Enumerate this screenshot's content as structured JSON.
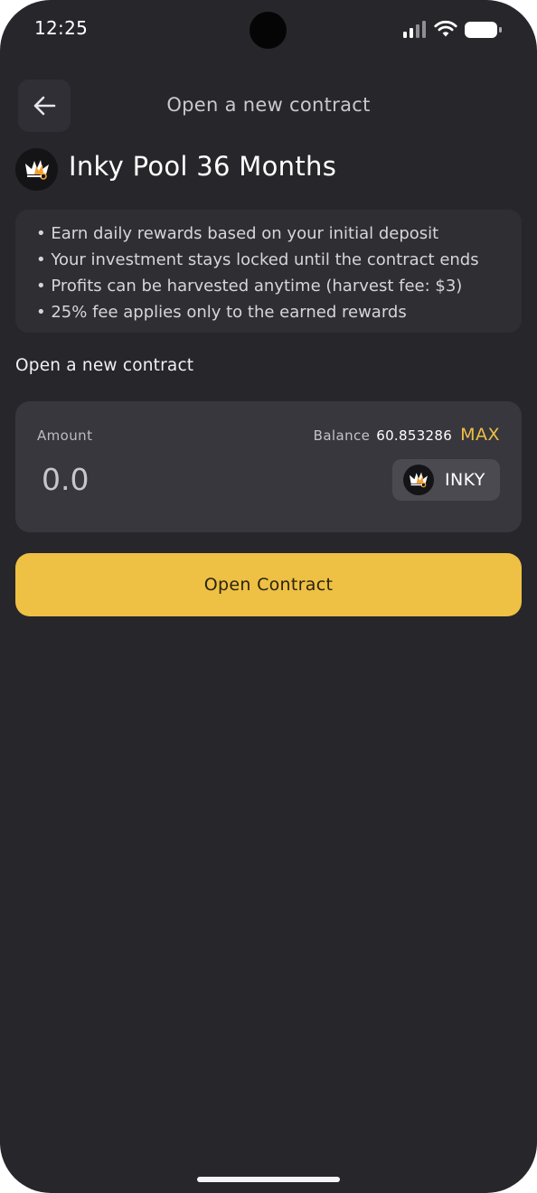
{
  "status_bar": {
    "time": "12:25",
    "icons": [
      "signal-icon",
      "wifi-icon",
      "battery-icon"
    ]
  },
  "header": {
    "back_icon": "arrow-left-icon",
    "title": "Open a new contract"
  },
  "pool": {
    "logo_icon": "crown-icon",
    "title": "Inky Pool 36 Months"
  },
  "info": {
    "lines": [
      "• Earn daily rewards based on your initial deposit",
      "• Your investment stays locked until the contract ends",
      "• Profits can be harvested anytime (harvest fee: $3)",
      "• 25% fee applies only to the earned rewards"
    ]
  },
  "section": {
    "label": "Open a new contract"
  },
  "amount_card": {
    "amount_label": "Amount",
    "balance_label": "Balance",
    "balance_value": "60.853286",
    "max_label": "MAX",
    "amount_value": "0.0",
    "token": {
      "icon": "crown-icon",
      "label": "INKY"
    }
  },
  "primary_button": {
    "label": "Open Contract"
  },
  "colors": {
    "background": "#27262b",
    "card": "#38373d",
    "accent": "#eec044",
    "max": "#efbf45"
  }
}
